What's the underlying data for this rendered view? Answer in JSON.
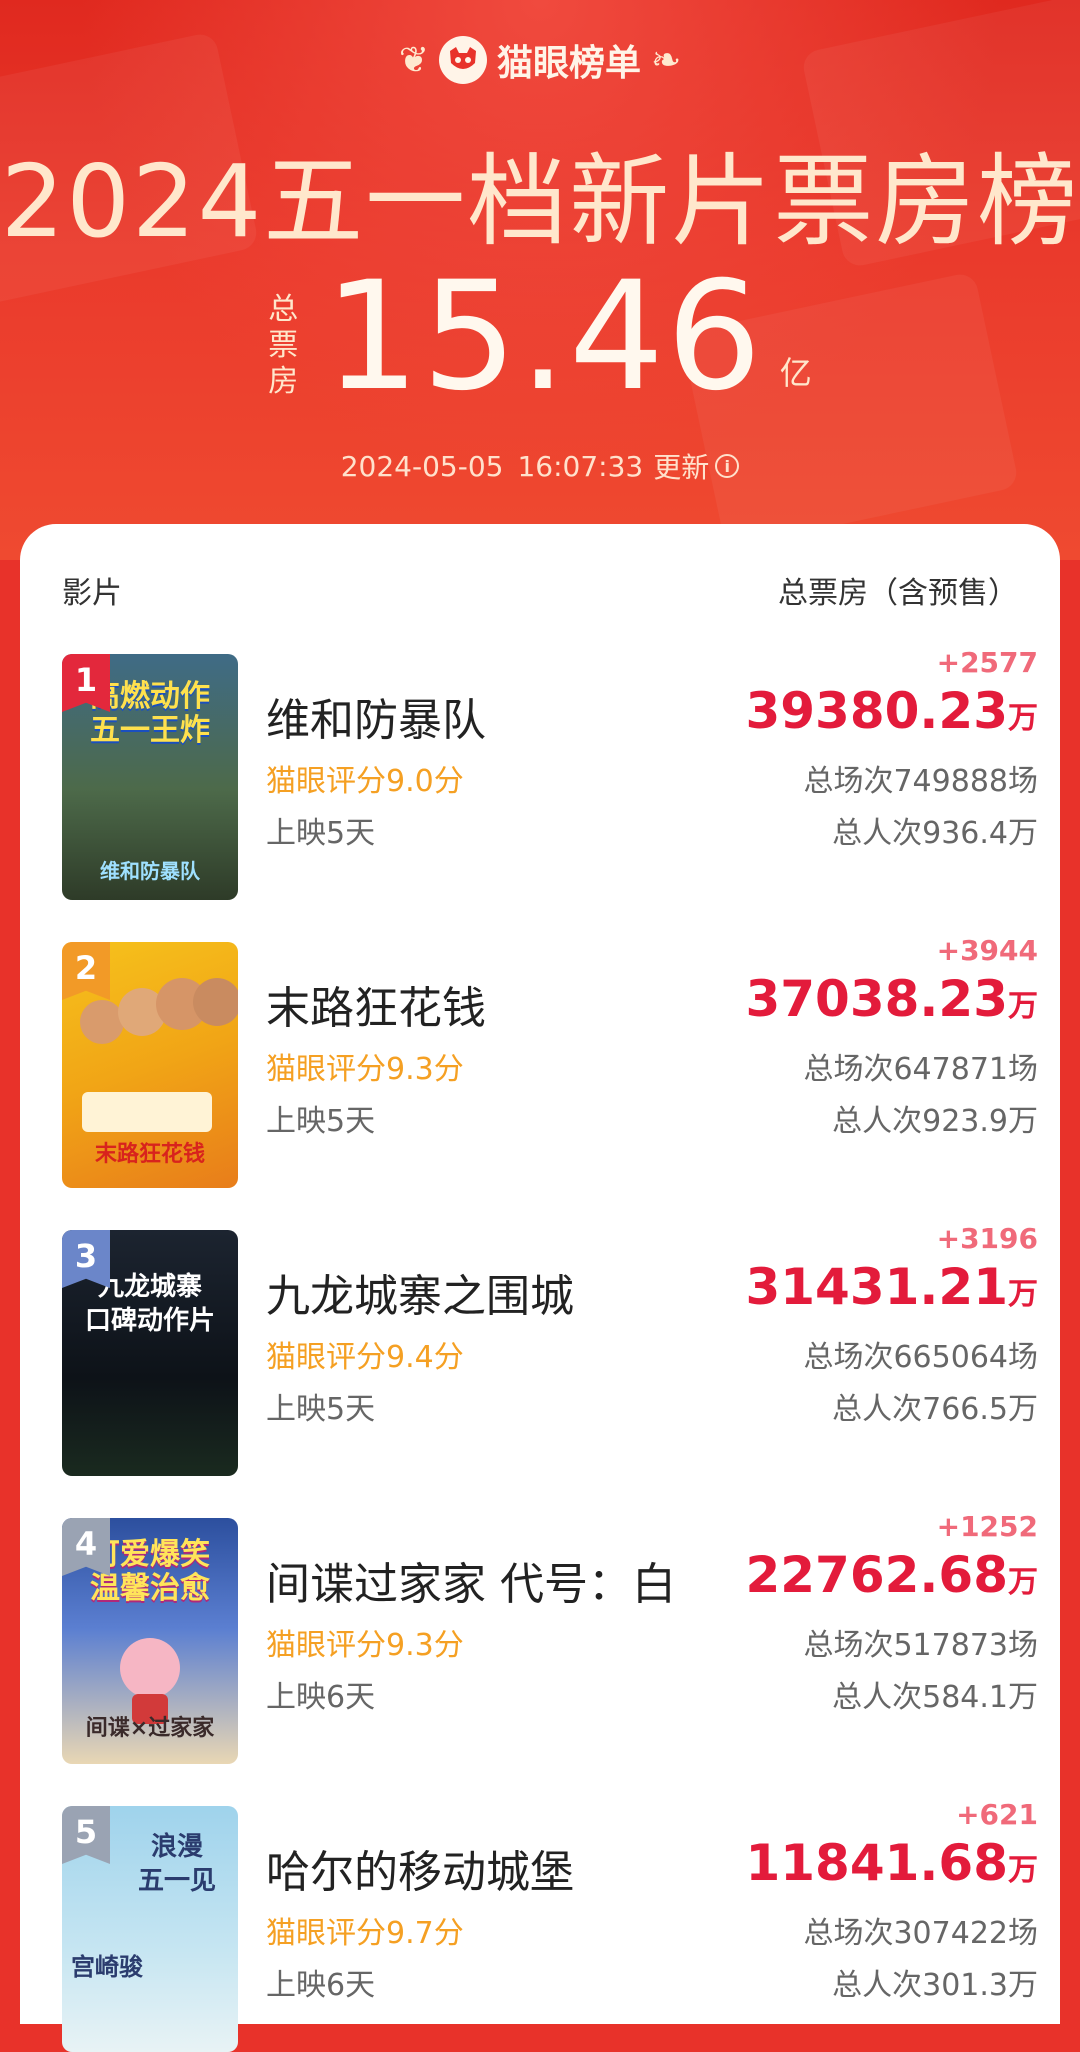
{
  "header": {
    "brand": "猫眼榜单",
    "title": "2024五一档新片票房榜",
    "total_label_chars": [
      "总",
      "票",
      "房"
    ],
    "total_value": "15.46",
    "total_unit": "亿",
    "update_date": "2024-05-05",
    "update_time": "16:07:33",
    "update_label": "更新",
    "colors": {
      "brand_red": "#e8322a",
      "title_cream": "#ffe7cc"
    }
  },
  "table": {
    "col_film": "影片",
    "col_box": "总票房（含预售）",
    "colors": {
      "box_red": "#e31b3b",
      "rating_orange": "#f5a023",
      "delta_pink": "#f06a7a"
    },
    "movies": [
      {
        "rank": "1",
        "name": "维和防暴队",
        "rating": "猫眼评分9.0分",
        "days": "上映5天",
        "delta": "+2577",
        "box": "39380.23",
        "unit": "万",
        "sessions": "总场次749888场",
        "people": "总人次936.4万",
        "poster_text": "高燃动作\n五一王炸",
        "poster_sub": "维和防暴队"
      },
      {
        "rank": "2",
        "name": "末路狂花钱",
        "rating": "猫眼评分9.3分",
        "days": "上映5天",
        "delta": "+3944",
        "box": "37038.23",
        "unit": "万",
        "sessions": "总场次647871场",
        "people": "总人次923.9万",
        "poster_text": "",
        "poster_sub": "末路狂花钱"
      },
      {
        "rank": "3",
        "name": "九龙城寨之围城",
        "rating": "猫眼评分9.4分",
        "days": "上映5天",
        "delta": "+3196",
        "box": "31431.21",
        "unit": "万",
        "sessions": "总场次665064场",
        "people": "总人次766.5万",
        "poster_text": "九龙城寨\n口碑动作片",
        "poster_sub": ""
      },
      {
        "rank": "4",
        "name": "间谍过家家 代号：白",
        "rating": "猫眼评分9.3分",
        "days": "上映6天",
        "delta": "+1252",
        "box": "22762.68",
        "unit": "万",
        "sessions": "总场次517873场",
        "people": "总人次584.1万",
        "poster_text": "可爱爆笑\n温馨治愈",
        "poster_sub": "间谍×过家家"
      },
      {
        "rank": "5",
        "name": "哈尔的移动城堡",
        "rating": "猫眼评分9.7分",
        "days": "上映6天",
        "delta": "+621",
        "box": "11841.68",
        "unit": "万",
        "sessions": "总场次307422场",
        "people": "总人次301.3万",
        "poster_text": "浪漫\n五一见",
        "poster_sub": "宫崎骏"
      }
    ]
  }
}
